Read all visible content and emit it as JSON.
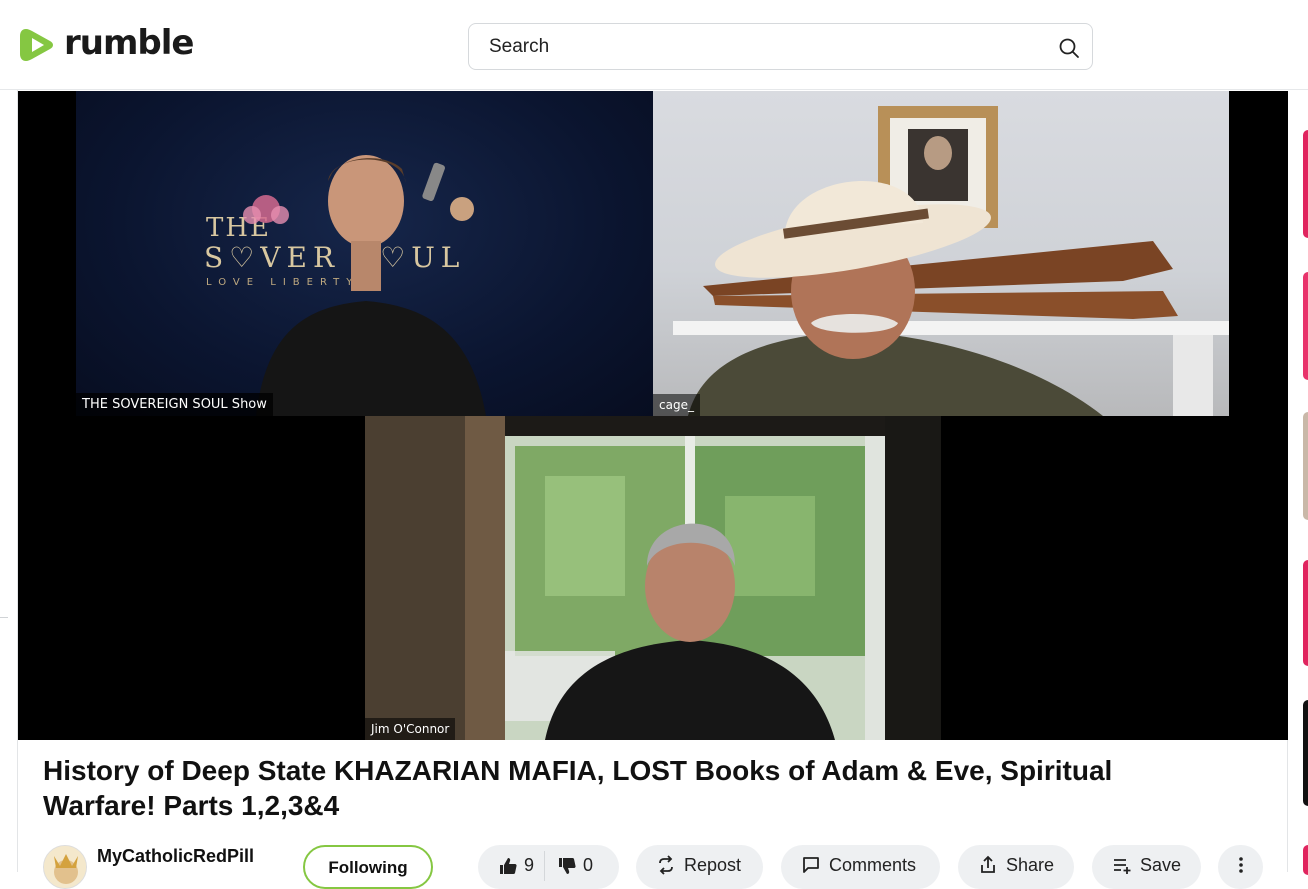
{
  "header": {
    "logo_text": "rumble",
    "search": {
      "placeholder": "Search"
    }
  },
  "video": {
    "participants": [
      {
        "label": "THE SOVEREIGN SOUL Show",
        "backdrop_text": "THE SOVEREIGN SOUL",
        "backdrop_tagline": "LOVE · LIBERTY"
      },
      {
        "label": "cage_"
      },
      {
        "label": "Jim O'Connor"
      }
    ]
  },
  "title": "History of Deep State KHAZARIAN MAFIA, LOST Books of Adam & Eve, Spiritual Warfare! Parts 1,2,3&4",
  "channel": {
    "name": "MyCatholicRedPill",
    "follow_label": "Following"
  },
  "actions": {
    "likes": "9",
    "dislikes": "0",
    "repost_label": "Repost",
    "comments_label": "Comments",
    "share_label": "Share",
    "save_label": "Save"
  },
  "colors": {
    "brand_green": "#85c742",
    "pill_bg": "#eef0f2"
  },
  "icons": [
    "rumble-logo-icon",
    "search-icon",
    "thumbs-up-icon",
    "thumbs-down-icon",
    "repost-icon",
    "comment-icon",
    "share-icon",
    "save-playlist-icon",
    "more-vertical-icon"
  ]
}
